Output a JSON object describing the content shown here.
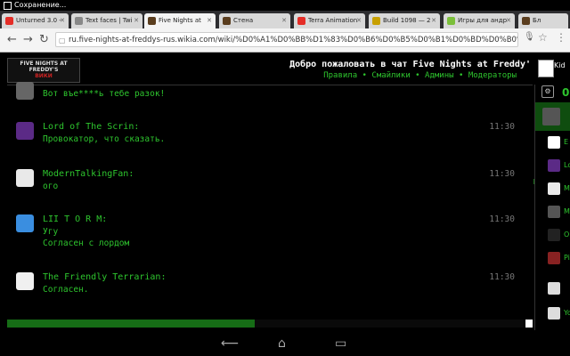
{
  "status": {
    "text": "Сохранение..."
  },
  "tabs": [
    {
      "label": "Unturned 3.0 -",
      "favicon_color": "#e52d27"
    },
    {
      "label": "Text faces | Twi",
      "favicon_color": "#888888"
    },
    {
      "label": "Five Nights at",
      "favicon_color": "#5a3d1e"
    },
    {
      "label": "Стена",
      "favicon_color": "#5a3d1e"
    },
    {
      "label": "Terra Animation",
      "favicon_color": "#e52d27"
    },
    {
      "label": "Build 1098 — 2",
      "favicon_color": "#c8a000"
    },
    {
      "label": "Игры для андр",
      "favicon_color": "#7bbf3a"
    },
    {
      "label": "Бл",
      "favicon_color": "#5a3d1e"
    }
  ],
  "url": {
    "value": "ru.five-nights-at-freddys-rus.wikia.com/wiki/%D0%A1%D0%BB%D1%83%D0%B6%D0%B5%D0%B1%D0%BD%D0%B0%D1%8F:C"
  },
  "header": {
    "logo_text": "FIVE NIGHTS AT FREDDY'S",
    "logo_wiki": "ВИКИ",
    "welcome": "Добро пожаловать в чат Five Nights at Freddy'",
    "links": [
      "Правила",
      "Смайлики",
      "Админы",
      "Модераторы"
    ],
    "link_sep": " • ",
    "kick_label": "Kid"
  },
  "messages": [
    {
      "user": "",
      "avatar_color": "#666666",
      "time": "",
      "lines": [
        "Вот въе****ь тебе разок!"
      ]
    },
    {
      "user": "Lord of The Scrin:",
      "avatar_color": "#5b2a86",
      "time": "11:30",
      "lines": [
        "Провокатор, что сказать."
      ]
    },
    {
      "user": "ModernTalkingFan:",
      "avatar_color": "#e9e9e9",
      "time": "11:30",
      "lines": [
        "ого"
      ]
    },
    {
      "user": "LII T O R M:",
      "avatar_color": "#3a8ee0",
      "time": "11:30",
      "lines": [
        "Угу",
        "Согласен с лордом"
      ]
    },
    {
      "user": "The Friendly Terrarian:",
      "avatar_color": "#f0f0f0",
      "time": "11:30",
      "lines": [
        "Согласен."
      ]
    }
  ],
  "input": {
    "progress": 0.48
  },
  "right": {
    "count": "0",
    "items": [
      {
        "label": "E",
        "color": "#ffffff"
      },
      {
        "label": "Lo",
        "color": "#5b2a86"
      },
      {
        "label": "M",
        "color": "#e9e9e9"
      },
      {
        "label": "M",
        "color": "#555555"
      },
      {
        "label": "O",
        "color": "#222222"
      },
      {
        "label": "Pi",
        "color": "#882222"
      },
      {
        "label": "",
        "color": "#dddddd"
      },
      {
        "label": "Yo",
        "color": "#dddddd"
      }
    ]
  },
  "navbar": {
    "back": "⟵",
    "home": "⌂",
    "recent": "▭"
  }
}
